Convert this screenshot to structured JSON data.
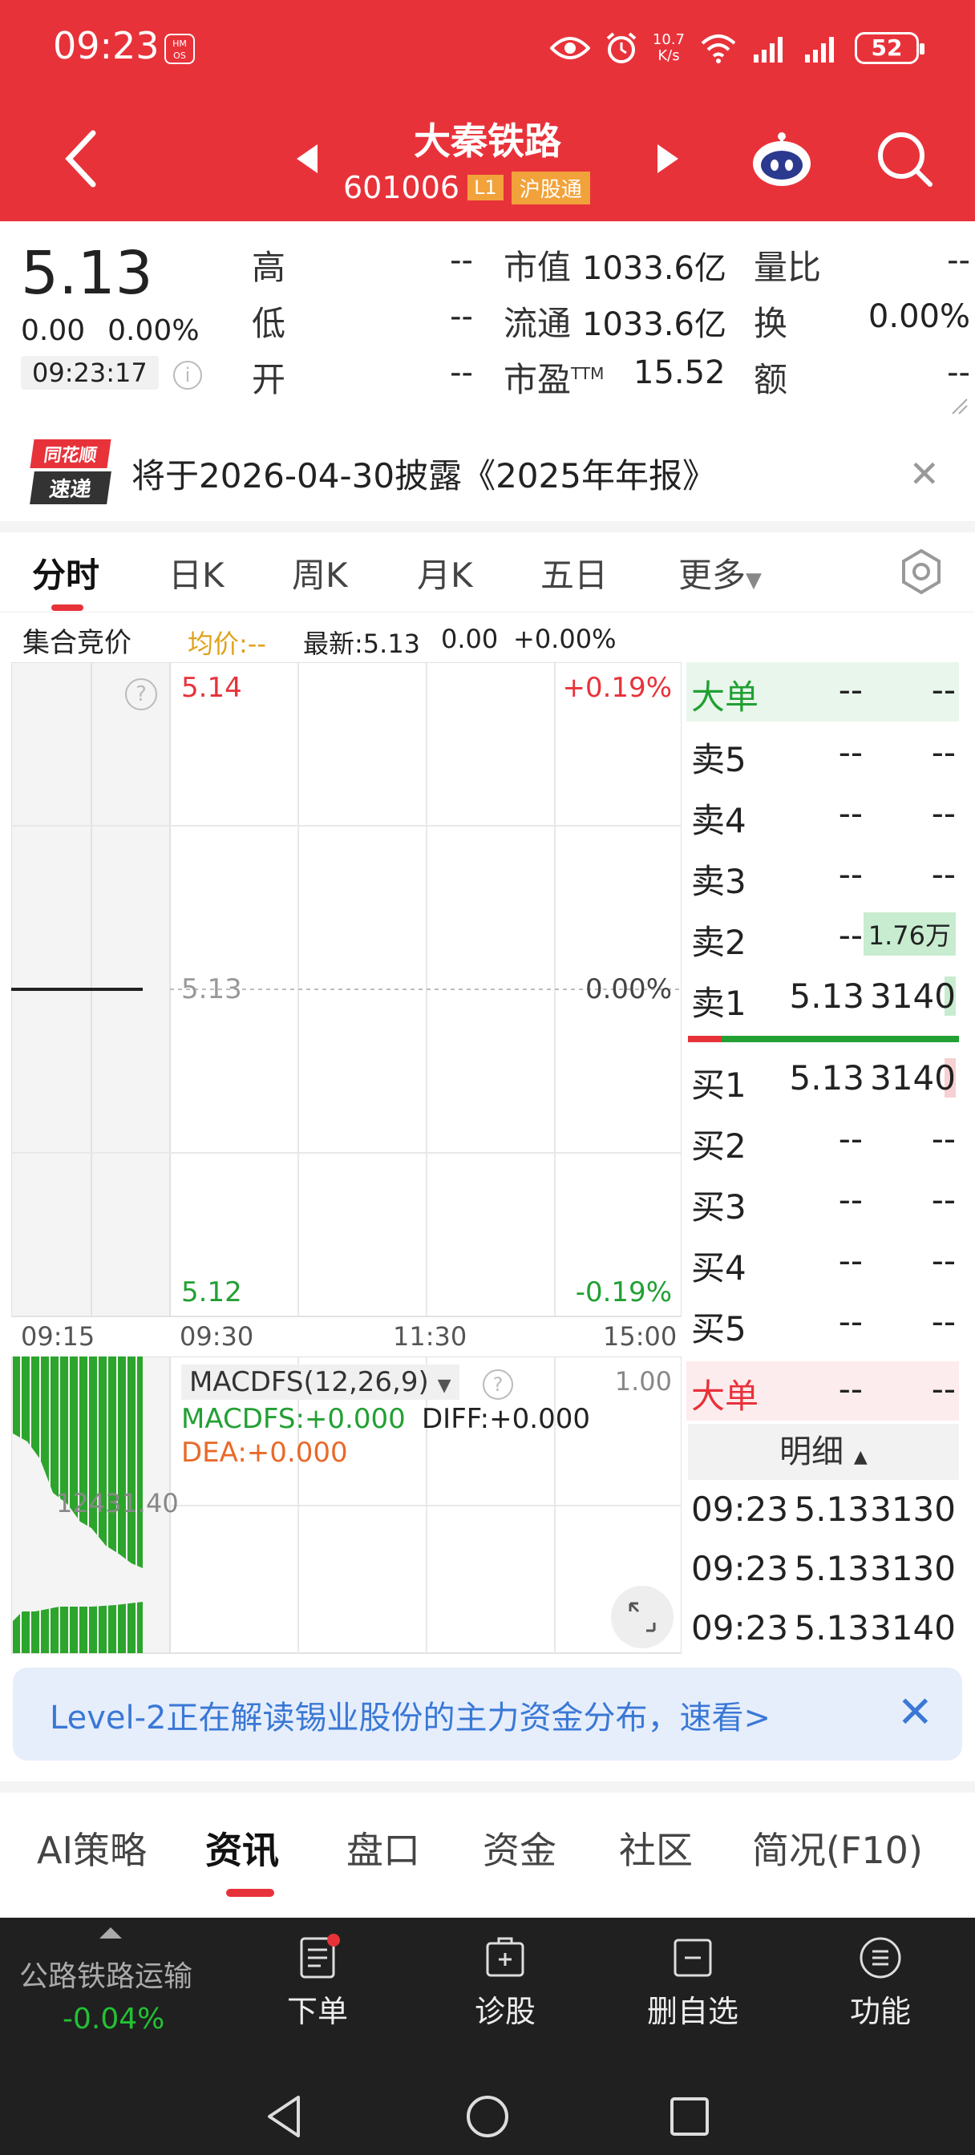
{
  "status_bar": {
    "time": "09:23",
    "hmos": "HM OS",
    "net_speed_top": "10.7",
    "net_speed_bottom": "K/s",
    "battery": "52"
  },
  "header": {
    "title": "大秦铁路",
    "code": "601006",
    "badge_level": "L1",
    "badge_connect": "沪股通",
    "bg_color": "#e8323a"
  },
  "quote": {
    "price": "5.13",
    "change": "0.00",
    "change_pct": "0.00%",
    "timestamp": "09:23:17",
    "fields": [
      {
        "label": "高",
        "value": "--"
      },
      {
        "label": "低",
        "value": "--"
      },
      {
        "label": "开",
        "value": "--"
      }
    ],
    "mcap_label": "市值",
    "mcap_value": "1033.6亿",
    "float_label": "流通",
    "float_value": "1033.6亿",
    "pe_label": "市盈",
    "pe_sup": "TTM",
    "pe_value": "15.52",
    "vr_label": "量比",
    "vr_value": "--",
    "turn_label": "换",
    "turn_value": "0.00%",
    "amt_label": "额",
    "amt_value": "--"
  },
  "notice": {
    "logo_top": "同花顺",
    "logo_bottom": "速递",
    "text": "将于2026-04-30披露《2025年年报》"
  },
  "chart_tabs": [
    {
      "label": "分时"
    },
    {
      "label": "日K"
    },
    {
      "label": "周K"
    },
    {
      "label": "月K"
    },
    {
      "label": "五日"
    },
    {
      "label": "更多"
    }
  ],
  "info_bar": {
    "phase": "集合竞价",
    "avg": "均价:--",
    "latest": "最新:5.13",
    "chg": "0.00",
    "chg_pct": "+0.00%"
  },
  "intraday": {
    "high_price": "5.14",
    "high_pct": "+0.19%",
    "mid_price": "5.13",
    "mid_pct": "0.00%",
    "low_price": "5.12",
    "low_pct": "-0.19%",
    "x_labels": [
      "09:15",
      "09:30",
      "11:30",
      "15:00"
    ],
    "volume_label": "12431.40"
  },
  "macd": {
    "title": "MACDFS(12,26,9)",
    "scale_top": "1.00",
    "macdfs": "MACDFS:+0.000",
    "diff": "DIFF:+0.000",
    "dea": "DEA:+0.000"
  },
  "orderbook": {
    "big_sell": {
      "label": "大单",
      "v1": "--",
      "v2": "--"
    },
    "asks": [
      {
        "label": "卖5",
        "price": "--",
        "vol": "--"
      },
      {
        "label": "卖4",
        "price": "--",
        "vol": "--"
      },
      {
        "label": "卖3",
        "price": "--",
        "vol": "--"
      },
      {
        "label": "卖2",
        "price": "--",
        "vol": "1.76万"
      },
      {
        "label": "卖1",
        "price": "5.13",
        "vol": "3140"
      }
    ],
    "bids": [
      {
        "label": "买1",
        "price": "5.13",
        "vol": "3140"
      },
      {
        "label": "买2",
        "price": "--",
        "vol": "--"
      },
      {
        "label": "买3",
        "price": "--",
        "vol": "--"
      },
      {
        "label": "买4",
        "price": "--",
        "vol": "--"
      },
      {
        "label": "买5",
        "price": "--",
        "vol": "--"
      }
    ],
    "big_buy": {
      "label": "大单",
      "v1": "--",
      "v2": "--"
    },
    "detail_label": "明细",
    "trades": [
      {
        "time": "09:23",
        "price": "5.13",
        "vol": "3130"
      },
      {
        "time": "09:23",
        "price": "5.13",
        "vol": "3130"
      },
      {
        "time": "09:23",
        "price": "5.13",
        "vol": "3140"
      }
    ]
  },
  "banner": {
    "text": "Level-2正在解读锡业股份的主力资金分布，速看>"
  },
  "bottom_tabs": [
    {
      "label": "AI策略"
    },
    {
      "label": "资讯"
    },
    {
      "label": "盘口"
    },
    {
      "label": "资金"
    },
    {
      "label": "社区"
    },
    {
      "label": "简况(F10)"
    }
  ],
  "bottom_bar": {
    "sector": "公路铁路运输",
    "sector_chg": "-0.04%",
    "items": [
      {
        "label": "下单",
        "icon": "order-icon"
      },
      {
        "label": "诊股",
        "icon": "diagnose-icon"
      },
      {
        "label": "删自选",
        "icon": "remove-watchlist-icon"
      },
      {
        "label": "功能",
        "icon": "menu-icon"
      }
    ]
  }
}
